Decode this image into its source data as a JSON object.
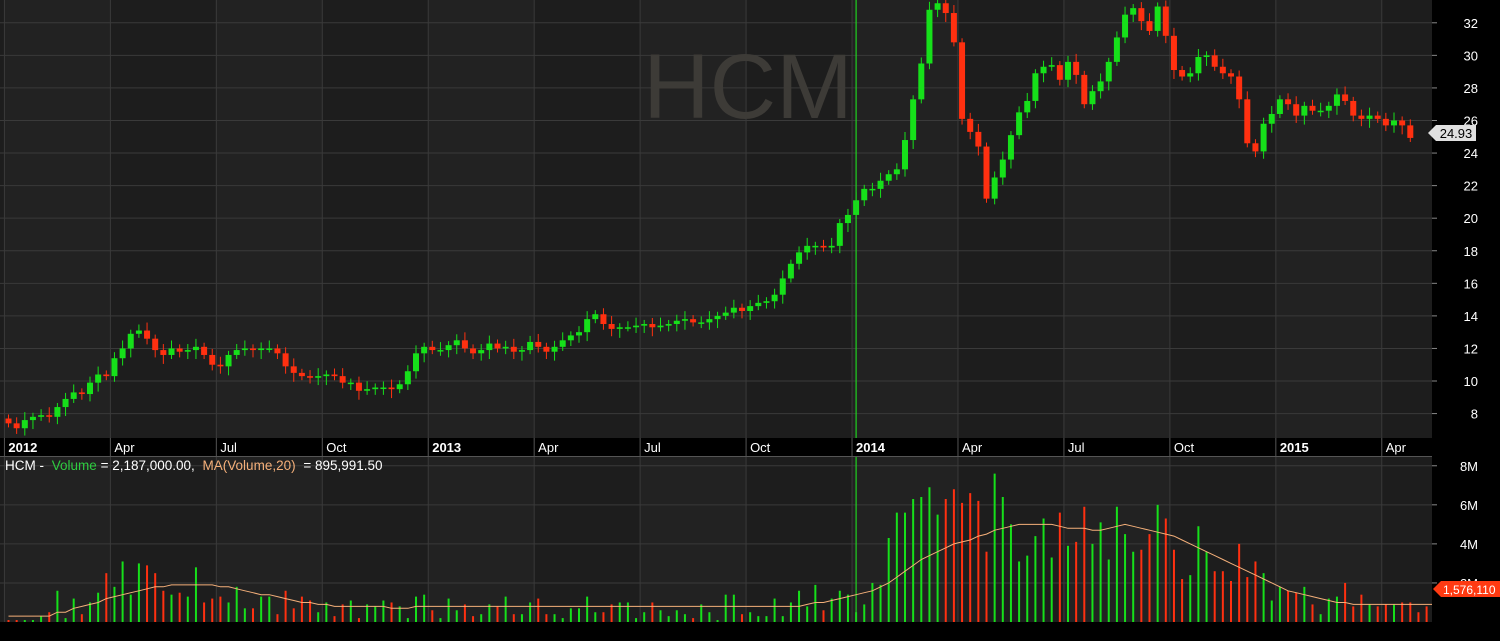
{
  "chart_data": [
    {
      "type": "candlestick",
      "symbol": "HCM",
      "watermark": "HCM",
      "ylim": [
        6.5,
        33.4
      ],
      "y_ticks": [
        8,
        10,
        12,
        14,
        16,
        18,
        20,
        22,
        24,
        26,
        28,
        30,
        32
      ],
      "last_price_label": "24.93",
      "x_labels": [
        {
          "week": 0,
          "label": "2012",
          "bold": true
        },
        {
          "week": 13,
          "label": "Apr",
          "bold": false
        },
        {
          "week": 26,
          "label": "Jul",
          "bold": false
        },
        {
          "week": 39,
          "label": "Oct",
          "bold": false
        },
        {
          "week": 52,
          "label": "2013",
          "bold": true
        },
        {
          "week": 65,
          "label": "Apr",
          "bold": false
        },
        {
          "week": 78,
          "label": "Jul",
          "bold": false
        },
        {
          "week": 91,
          "label": "Oct",
          "bold": false
        },
        {
          "week": 104,
          "label": "2014",
          "bold": true
        },
        {
          "week": 117,
          "label": "Apr",
          "bold": false
        },
        {
          "week": 130,
          "label": "Jul",
          "bold": false
        },
        {
          "week": 143,
          "label": "Oct",
          "bold": false
        },
        {
          "week": 156,
          "label": "2015",
          "bold": true
        },
        {
          "week": 169,
          "label": "Apr",
          "bold": false
        }
      ],
      "closes": [
        7.4,
        7.1,
        7.6,
        7.8,
        7.9,
        7.8,
        8.4,
        8.9,
        9.3,
        9.2,
        9.9,
        10.4,
        10.3,
        11.4,
        12.0,
        12.9,
        13.1,
        12.6,
        11.9,
        11.6,
        12.0,
        11.8,
        11.9,
        12.1,
        11.6,
        11.0,
        10.9,
        11.6,
        11.9,
        12.0,
        11.9,
        12.0,
        12.0,
        11.7,
        10.9,
        10.5,
        10.3,
        10.2,
        10.3,
        10.4,
        10.3,
        9.9,
        9.9,
        9.4,
        9.5,
        9.6,
        9.6,
        9.5,
        9.8,
        10.6,
        11.7,
        12.1,
        11.9,
        11.9,
        12.2,
        12.5,
        12.0,
        11.7,
        11.9,
        12.3,
        12.0,
        12.1,
        11.8,
        11.9,
        12.4,
        12.1,
        11.8,
        12.1,
        12.5,
        12.8,
        13.0,
        13.8,
        14.1,
        13.5,
        13.2,
        13.3,
        13.3,
        13.4,
        13.5,
        13.3,
        13.4,
        13.5,
        13.7,
        13.8,
        13.6,
        13.6,
        13.8,
        14.0,
        14.2,
        14.5,
        14.3,
        14.6,
        14.8,
        14.9,
        15.3,
        16.3,
        17.2,
        17.9,
        18.3,
        18.3,
        18.2,
        18.3,
        19.7,
        20.2,
        21.1,
        21.8,
        21.8,
        22.3,
        22.7,
        23.0,
        24.8,
        27.3,
        29.5,
        32.8,
        33.2,
        32.6,
        30.8,
        26.1,
        25.3,
        24.4,
        21.2,
        22.5,
        23.6,
        25.1,
        26.5,
        27.2,
        28.9,
        29.3,
        29.4,
        28.5,
        29.6,
        28.8,
        27.0,
        27.8,
        28.4,
        29.6,
        31.1,
        32.5,
        32.9,
        32.1,
        31.5,
        33.0,
        31.2,
        29.1,
        28.7,
        28.9,
        29.9,
        30.0,
        29.3,
        28.9,
        28.7,
        27.3,
        24.6,
        24.1,
        25.8,
        26.4,
        27.3,
        27.0,
        26.3,
        26.9,
        26.6,
        26.6,
        26.9,
        27.6,
        27.2,
        26.3,
        26.1,
        26.3,
        26.1,
        25.7,
        26.0,
        25.7,
        24.93
      ],
      "volumes": [
        0.1,
        0.1,
        0.1,
        0.1,
        0.3,
        0.5,
        1.6,
        0.2,
        1.2,
        0.4,
        1.0,
        1.5,
        2.5,
        1.8,
        3.1,
        1.4,
        3.0,
        2.9,
        2.5,
        1.6,
        1.4,
        1.5,
        1.3,
        2.8,
        1.0,
        1.2,
        1.3,
        1.0,
        1.8,
        0.7,
        0.7,
        1.3,
        1.3,
        0.4,
        1.6,
        0.7,
        1.3,
        1.1,
        0.5,
        1.0,
        0.3,
        0.9,
        1.1,
        0.2,
        0.9,
        0.8,
        1.1,
        1.0,
        0.8,
        0.2,
        1.3,
        1.4,
        0.6,
        0.2,
        1.2,
        0.6,
        0.9,
        0.3,
        0.4,
        0.9,
        0.8,
        1.3,
        0.4,
        0.4,
        1.0,
        1.2,
        0.4,
        0.4,
        0.2,
        0.7,
        0.7,
        1.3,
        0.5,
        0.5,
        0.9,
        1.0,
        1.0,
        0.2,
        0.5,
        1.0,
        0.6,
        0.3,
        0.6,
        0.4,
        0.2,
        0.9,
        0.5,
        0.1,
        1.4,
        1.4,
        0.4,
        0.5,
        0.3,
        0.3,
        1.2,
        0.3,
        1.0,
        1.6,
        0.8,
        1.9,
        0.6,
        1.2,
        1.6,
        1.4,
        0.5,
        0.9,
        2.0,
        1.9,
        4.3,
        5.6,
        5.6,
        6.3,
        6.4,
        6.9,
        5.5,
        6.3,
        6.8,
        6.1,
        6.6,
        6.2,
        3.6,
        7.6,
        6.4,
        5.0,
        3.1,
        3.4,
        4.4,
        5.3,
        3.3,
        5.6,
        3.9,
        4.1,
        5.9,
        4.0,
        5.1,
        3.2,
        5.9,
        4.5,
        3.6,
        3.7,
        4.5,
        6.0,
        5.3,
        3.7,
        2.2,
        2.4,
        4.9,
        3.6,
        2.6,
        2.6,
        2.1,
        4.0,
        2.3,
        3.1,
        2.5,
        1.1,
        1.8,
        1.6,
        1.5,
        1.8,
        0.9,
        0.4,
        1.2,
        1.3,
        2.0,
        0.8,
        1.4,
        0.9,
        0.8,
        0.9,
        0.9,
        1.0,
        1.0,
        0.5,
        0.8,
        1.6
      ],
      "volume_ma20": [
        0.3,
        0.3,
        0.3,
        0.3,
        0.3,
        0.3,
        0.5,
        0.5,
        0.7,
        0.8,
        0.9,
        1.0,
        1.2,
        1.3,
        1.4,
        1.5,
        1.6,
        1.7,
        1.8,
        1.8,
        1.9,
        1.9,
        1.9,
        1.9,
        1.9,
        1.9,
        1.8,
        1.8,
        1.7,
        1.6,
        1.5,
        1.4,
        1.4,
        1.3,
        1.2,
        1.1,
        1.0,
        1.0,
        0.9,
        0.9,
        0.8,
        0.8,
        0.8,
        0.8,
        0.8,
        0.8,
        0.8,
        0.7,
        0.7,
        0.7,
        0.8,
        0.8,
        0.8,
        0.8,
        0.8,
        0.8,
        0.8,
        0.8,
        0.8,
        0.8,
        0.8,
        0.8,
        0.8,
        0.8,
        0.8,
        0.8,
        0.8,
        0.8,
        0.8,
        0.8,
        0.8,
        0.8,
        0.8,
        0.8,
        0.8,
        0.8,
        0.8,
        0.8,
        0.8,
        0.8,
        0.8,
        0.8,
        0.8,
        0.8,
        0.8,
        0.8,
        0.8,
        0.8,
        0.8,
        0.8,
        0.8,
        0.8,
        0.8,
        0.8,
        0.8,
        0.8,
        0.8,
        0.8,
        0.9,
        1.0,
        1.0,
        1.1,
        1.2,
        1.3,
        1.4,
        1.5,
        1.6,
        1.8,
        2.0,
        2.3,
        2.6,
        2.9,
        3.2,
        3.4,
        3.6,
        3.8,
        4.0,
        4.1,
        4.2,
        4.4,
        4.5,
        4.7,
        4.8,
        4.9,
        5.0,
        5.0,
        5.0,
        5.0,
        5.0,
        4.9,
        4.8,
        4.8,
        4.8,
        4.7,
        4.7,
        4.8,
        4.9,
        5.0,
        4.9,
        4.8,
        4.7,
        4.6,
        4.5,
        4.4,
        4.2,
        4.0,
        3.8,
        3.6,
        3.4,
        3.2,
        3.0,
        2.8,
        2.6,
        2.4,
        2.2,
        2.0,
        1.8,
        1.6,
        1.5,
        1.4,
        1.3,
        1.2,
        1.1,
        1.0,
        1.0,
        0.9,
        0.9,
        0.9,
        0.9,
        0.9,
        0.9,
        0.9,
        0.9,
        0.9,
        0.9,
        0.9
      ],
      "spike_week": 104
    },
    {
      "type": "bar",
      "legend_symbol": "HCM -",
      "legend_volume": "Volume = 2,187,000.00,",
      "legend_ma": "MA(Volume,20)",
      "legend_ma_value": "= 895,991.50",
      "ylim": [
        0,
        8.5
      ],
      "y_ticks": [
        "2M",
        "4M",
        "6M",
        "8M"
      ],
      "last_volume_label": "1,576,110"
    }
  ],
  "colors": {
    "up": "#16e01a",
    "down": "#ff3010",
    "ma_line": "#f5b07a",
    "legend_green": "#2ecc40",
    "legend_orange": "#f5b07a"
  }
}
